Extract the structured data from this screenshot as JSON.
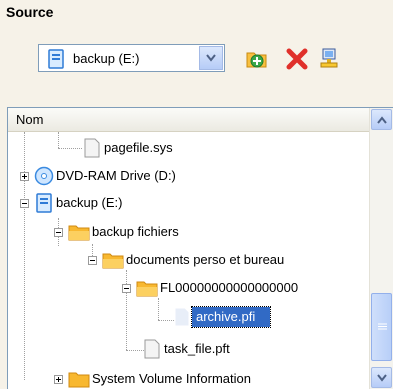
{
  "section_title": "Source",
  "drive_select": {
    "value": "backup (E:)"
  },
  "toolbar": {
    "new_folder_icon": "folder-add-icon",
    "delete_icon": "delete-x-icon",
    "properties_icon": "network-computer-icon"
  },
  "tree": {
    "column_header": "Nom",
    "items": [
      {
        "label": "pagefile.sys"
      },
      {
        "label": "DVD-RAM Drive (D:)"
      },
      {
        "label": "backup (E:)"
      },
      {
        "label": "backup fichiers"
      },
      {
        "label": "documents perso et bureau"
      },
      {
        "label": "FL00000000000000000"
      },
      {
        "label": "archive.pfi",
        "selected": true
      },
      {
        "label": "task_file.pft"
      },
      {
        "label": "System Volume Information"
      }
    ]
  },
  "colors": {
    "selection": "#316ac5",
    "folder": "#f8b830",
    "panel_bg": "#f6f2e8"
  }
}
